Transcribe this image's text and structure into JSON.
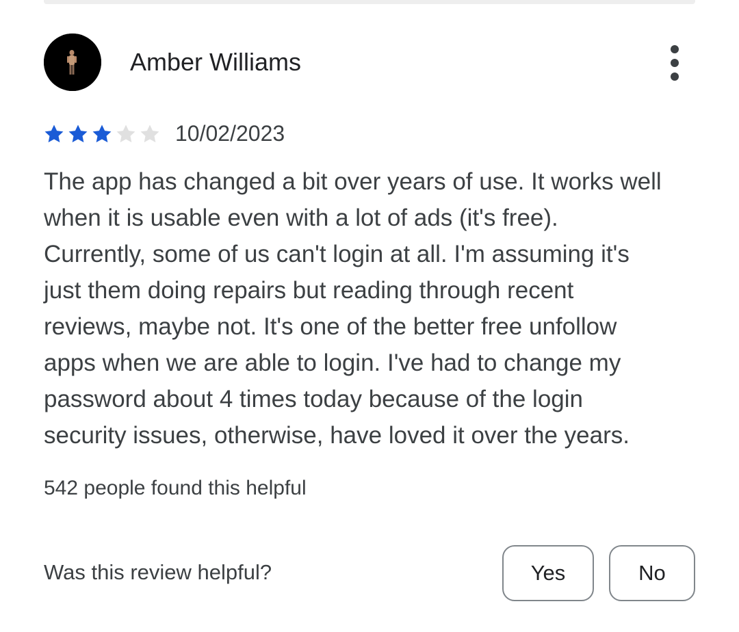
{
  "review": {
    "reviewer_name": "Amber Williams",
    "rating": 3,
    "max_rating": 5,
    "date": "10/02/2023",
    "text_lines": [
      "The app has changed a bit over years of use. It works well",
      "when it is usable even with a lot of ads (it's free).",
      "Currently, some of us can't login at all. I'm assuming it's",
      "just them doing repairs but reading through recent",
      "reviews, maybe not. It's one of the better free unfollow",
      "apps when we are able to login. I've had to change my",
      "password about 4 times today because of the login",
      "security issues, otherwise, have loved it over the years."
    ],
    "helpful_count_text": "542 people found this helpful",
    "helpful_question": "Was this review helpful?",
    "yes_label": "Yes",
    "no_label": "No"
  },
  "icons": {
    "avatar": "avatar-photo",
    "more": "more-vert-icon",
    "star_filled": "star-filled-icon",
    "star_empty": "star-empty-icon"
  },
  "colors": {
    "star_filled": "#1a5bd6",
    "star_empty": "#e0e0e0",
    "text_primary": "#202124",
    "text_secondary": "#3c4043",
    "button_border": "#80868b",
    "divider": "#eeeeee"
  }
}
